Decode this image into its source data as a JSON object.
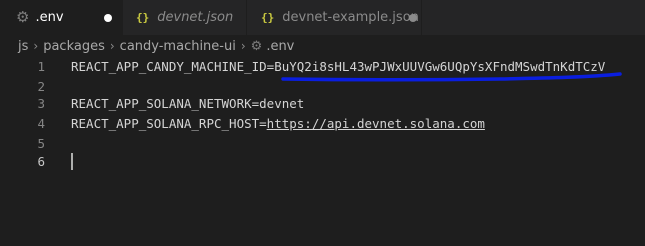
{
  "tabs": [
    {
      "name": ".env",
      "icon": "gear-icon",
      "active": true,
      "dirty": true
    },
    {
      "name": "devnet.json",
      "icon": "json-icon",
      "icon_glyph": "{}",
      "active": false,
      "deleted": true
    },
    {
      "name": "devnet-example.json",
      "icon": "json-icon",
      "icon_glyph": "{}",
      "active": false,
      "dirty": true
    }
  ],
  "breadcrumb": [
    "js",
    "packages",
    "candy-machine-ui",
    ".env"
  ],
  "lines": [
    {
      "number": "1",
      "key": "REACT_APP_CANDY_MACHINE_ID=",
      "value": "BuYQ2i8sHL43wPJWxUUVGw6UQpYsXFndMSwdTnKdTCzV"
    },
    {
      "number": "2",
      "text": ""
    },
    {
      "number": "3",
      "key": "REACT_APP_SOLANA_NETWORK=",
      "value": "devnet"
    },
    {
      "number": "4",
      "key": "REACT_APP_SOLANA_RPC_HOST=",
      "value": "https://api.devnet.solana.com"
    },
    {
      "number": "5",
      "text": ""
    },
    {
      "number": "6",
      "text": ""
    }
  ],
  "colors": {
    "annotation": "#0a1ee0",
    "editor_bg": "#1e1e1e",
    "tabbar_bg": "#252526",
    "json_icon": "#cbcb41"
  }
}
